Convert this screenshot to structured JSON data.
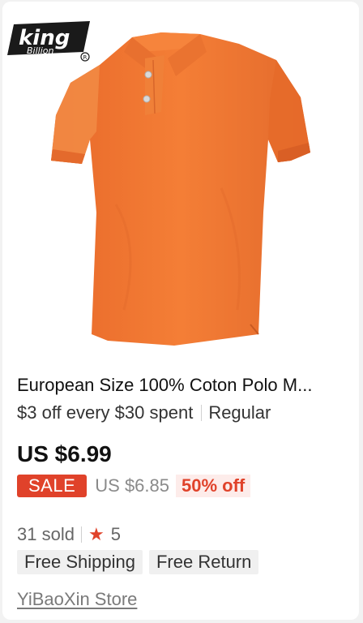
{
  "product": {
    "brand_logo": {
      "word": "king",
      "sub": "Billion",
      "mark": "R"
    },
    "title": "European Size 100% Coton Polo M...",
    "promo": {
      "coupon": "$3 off every $30 spent",
      "tag": "Regular"
    },
    "price": "US $6.99",
    "sale": {
      "badge": "SALE",
      "original_price": "US $6.85",
      "discount": "50% off"
    },
    "stats": {
      "sold": "31 sold",
      "rating": "5"
    },
    "tags": [
      "Free Shipping",
      "Free Return"
    ],
    "store": "YiBaoXin Store"
  },
  "colors": {
    "accent": "#e0422a",
    "shirt": "#f07a32",
    "card_bg": "#ffffff",
    "page_bg": "#f2f2f2"
  },
  "icons": {
    "rating": "star-icon"
  }
}
